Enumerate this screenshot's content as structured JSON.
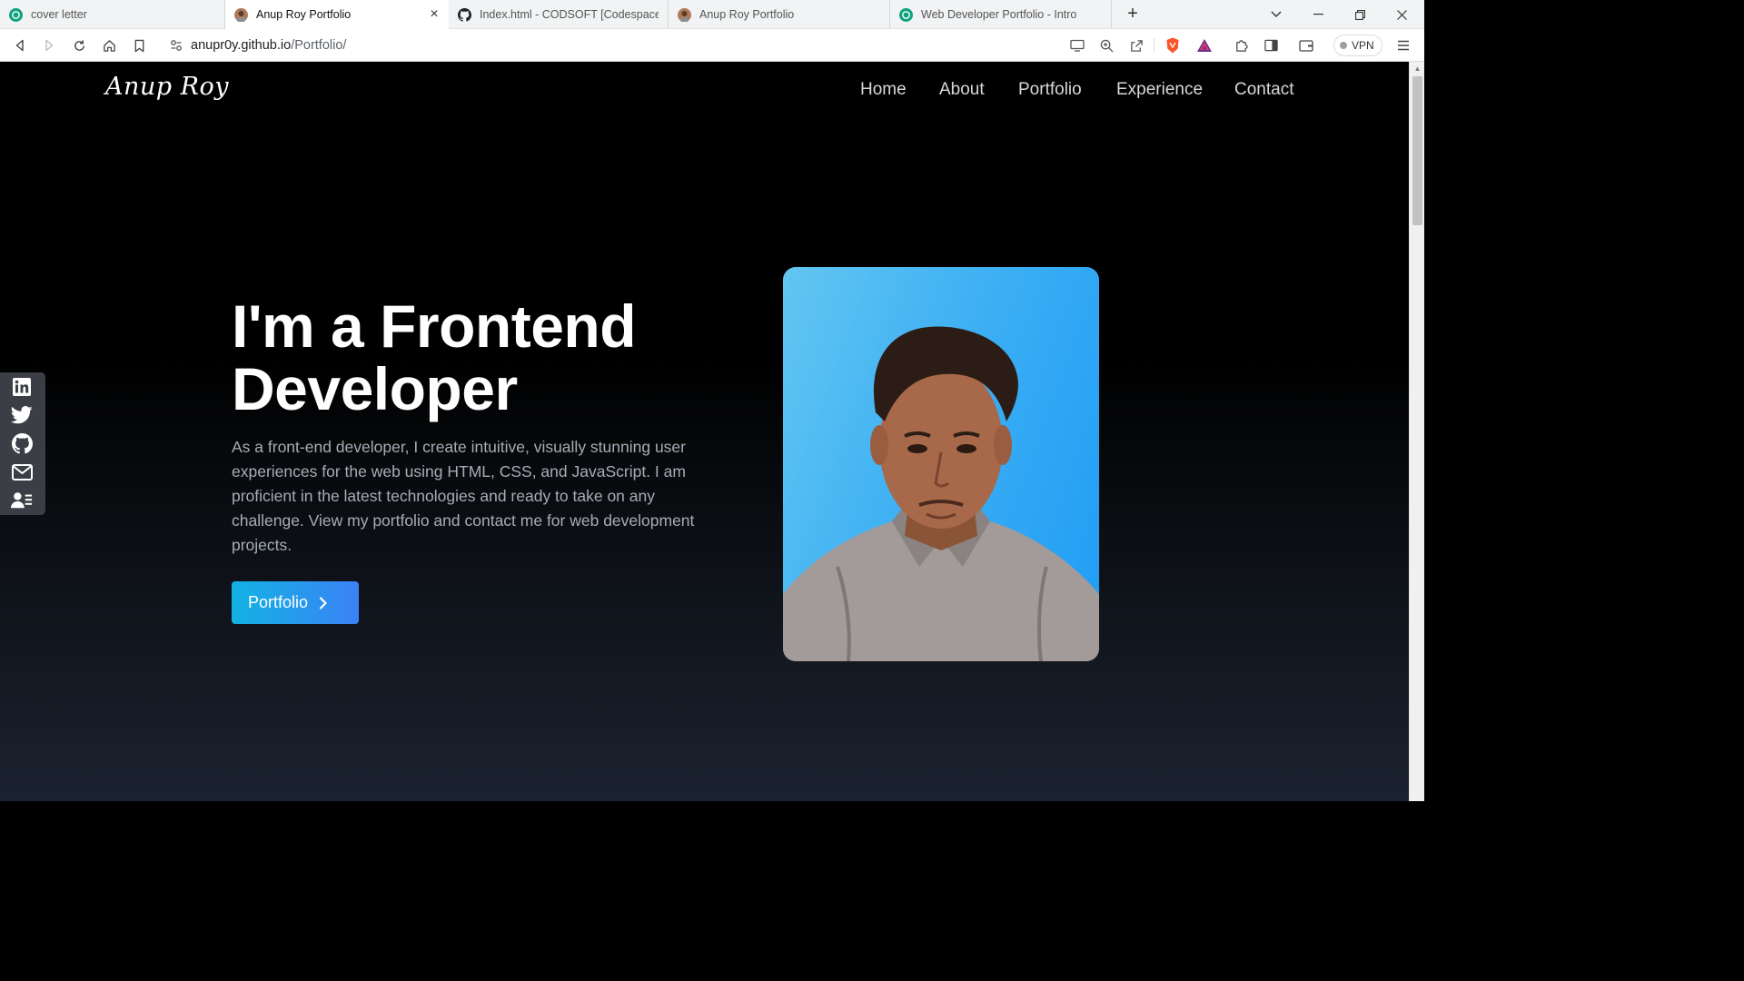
{
  "browser": {
    "tabs": [
      {
        "title": "cover letter",
        "active": false
      },
      {
        "title": "Anup Roy Portfolio",
        "active": true
      },
      {
        "title": "Index.html - CODSOFT [Codespaces: f",
        "active": false
      },
      {
        "title": "Anup Roy Portfolio",
        "active": false
      },
      {
        "title": "Web Developer Portfolio - Intro",
        "active": false
      }
    ],
    "url_host": "anupr0y.github.io",
    "url_path": "/Portfolio/",
    "vpn_label": "VPN"
  },
  "site": {
    "logo": "Anup Roy",
    "nav": [
      "Home",
      "About",
      "Portfolio",
      "Experience",
      "Contact"
    ]
  },
  "hero": {
    "title_line1": "I'm a Frontend",
    "title_line2": "Developer",
    "description": "As a front-end developer, I create intuitive, visually stunning user experiences for the web using HTML, CSS, and JavaScript. I am proficient in the latest technologies and ready to take on any challenge. View my portfolio and contact me for web development projects.",
    "cta_label": "Portfolio"
  },
  "social_icons": [
    "linkedin-icon",
    "twitter-icon",
    "github-icon",
    "email-icon",
    "resume-icon"
  ],
  "colors": {
    "cta_start": "#12b2e3",
    "cta_end": "#3b82f6",
    "photo_bg": "#1f9cf5",
    "social_bar": "#3b3f45"
  }
}
